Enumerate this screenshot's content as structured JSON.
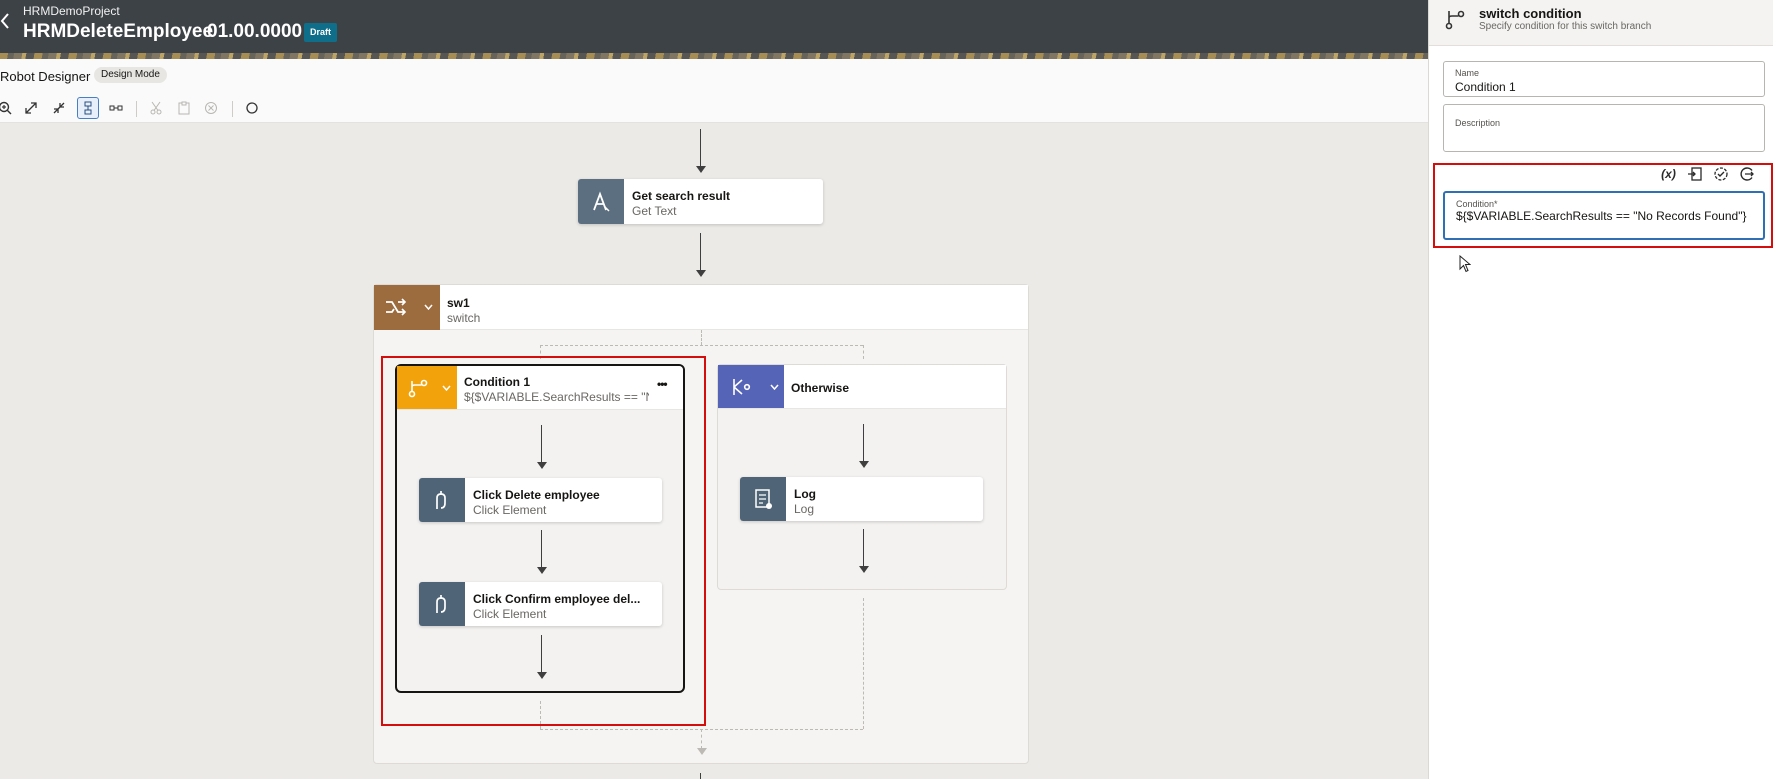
{
  "header": {
    "project": "HRMDemoProject",
    "title": "HRMDeleteEmployee",
    "version": "01.00.0000",
    "status": "Draft"
  },
  "subheader": {
    "designer_label": "Robot Designer",
    "mode": "Design Mode"
  },
  "toolbar": {
    "icons": [
      "zoom-in-icon",
      "expand-icon",
      "collapse-icon",
      "vertical-layout-icon",
      "horizontal-layout-icon",
      "cut-icon",
      "paste-icon",
      "delete-icon",
      "circle-icon"
    ]
  },
  "canvas": {
    "nodes": {
      "get_text": {
        "title": "Get search result",
        "subtitle": "Get Text",
        "color": "#5b6f80"
      },
      "switch": {
        "title": "sw1",
        "subtitle": "switch",
        "color": "#9c6b3e"
      },
      "condition": {
        "title": "Condition 1",
        "subtitle": "${$VARIABLE.SearchResults == \"N...",
        "more": "•••",
        "color": "#f2a30b"
      },
      "otherwise": {
        "title": "Otherwise",
        "color": "#5664b8"
      },
      "click_delete": {
        "title": "Click Delete employee",
        "subtitle": "Click Element",
        "color": "#4f6577"
      },
      "click_confirm": {
        "title": "Click Confirm employee del...",
        "subtitle": "Click Element",
        "color": "#4f6577"
      },
      "log": {
        "title": "Log",
        "subtitle": "Log",
        "color": "#4f6577"
      }
    }
  },
  "panel": {
    "title": "switch condition",
    "subtitle": "Specify condition for this switch branch",
    "name_label": "Name",
    "name_value": "Condition 1",
    "description_label": "Description",
    "description_value": "",
    "condition_label": "Condition*",
    "condition_value": "${$VARIABLE.SearchResults == \"No Records Found\"}",
    "condition_tools": {
      "variable": "(x)"
    },
    "accent": "#2f6fb3",
    "highlight": "#d40d0d"
  }
}
